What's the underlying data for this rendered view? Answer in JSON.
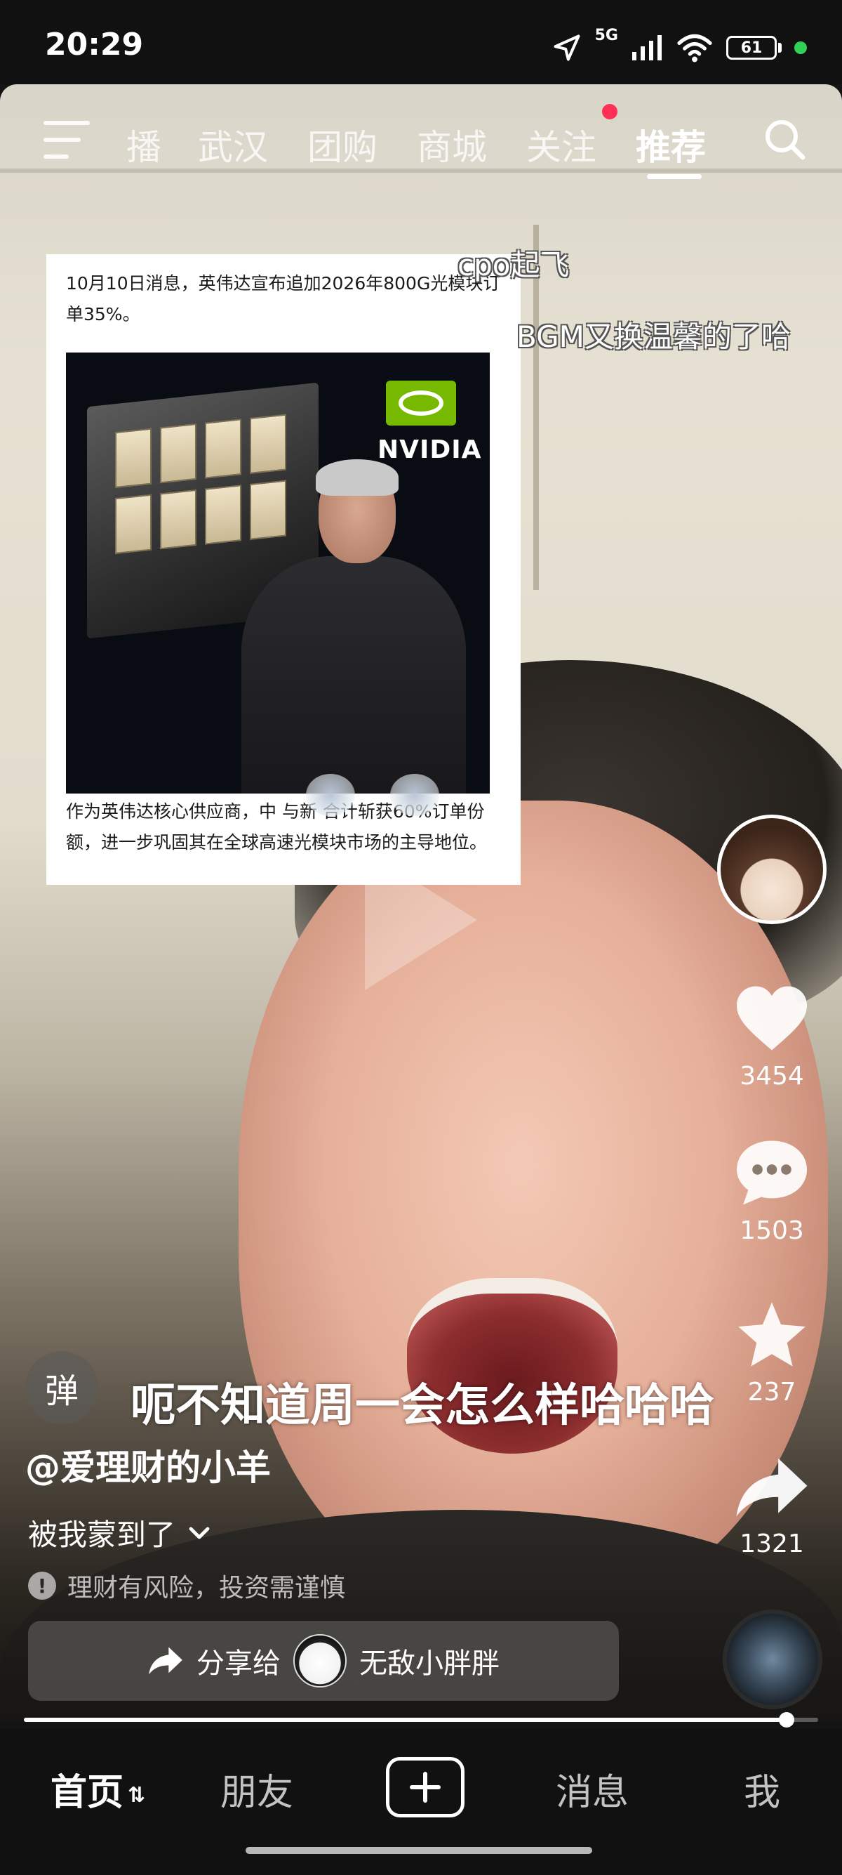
{
  "status_bar": {
    "time": "20:29",
    "network": "5G",
    "battery": "61",
    "icons": [
      "location-arrow-icon",
      "signal-bars-icon",
      "wifi-icon",
      "battery-icon"
    ]
  },
  "top_nav": {
    "tabs": [
      {
        "label": "播"
      },
      {
        "label": "武汉"
      },
      {
        "label": "团购"
      },
      {
        "label": "商城"
      },
      {
        "label": "关注"
      },
      {
        "label": "推荐"
      }
    ],
    "active_tab": "推荐"
  },
  "news_card": {
    "top_text": "10月10日消息，英伟达宣布追加2026年800G光模块订单35%。",
    "brand_text": "NVIDIA",
    "bottom_text": "作为英伟达核心供应商，中 与新 合计斩获60%订单份额，进一步巩固其在全球高速光模块市场的主导地位。"
  },
  "danmaku": [
    "cpo起飞",
    "BGM又换温馨的了哈"
  ],
  "right_rail": {
    "like_count": "3454",
    "comment_count": "1503",
    "favorite_count": "237",
    "share_count": "1321"
  },
  "bottom_info": {
    "danmu_toggle": "弹",
    "subtitle": "呃不知道周一会怎么样哈哈哈",
    "username": "@爱理财的小羊",
    "caption": "被我蒙到了",
    "risk_notice": "理财有风险，投资需谨慎",
    "share_label": "分享给",
    "share_target": "无敌小胖胖"
  },
  "progress": {
    "fraction": 0.96
  },
  "bottom_nav": {
    "items": [
      "首页",
      "朋友",
      "消息",
      "我"
    ]
  },
  "colors": {
    "accent_red": "#ff2f55",
    "battery_dot": "#31d158",
    "nvidia_green": "#76b900"
  }
}
